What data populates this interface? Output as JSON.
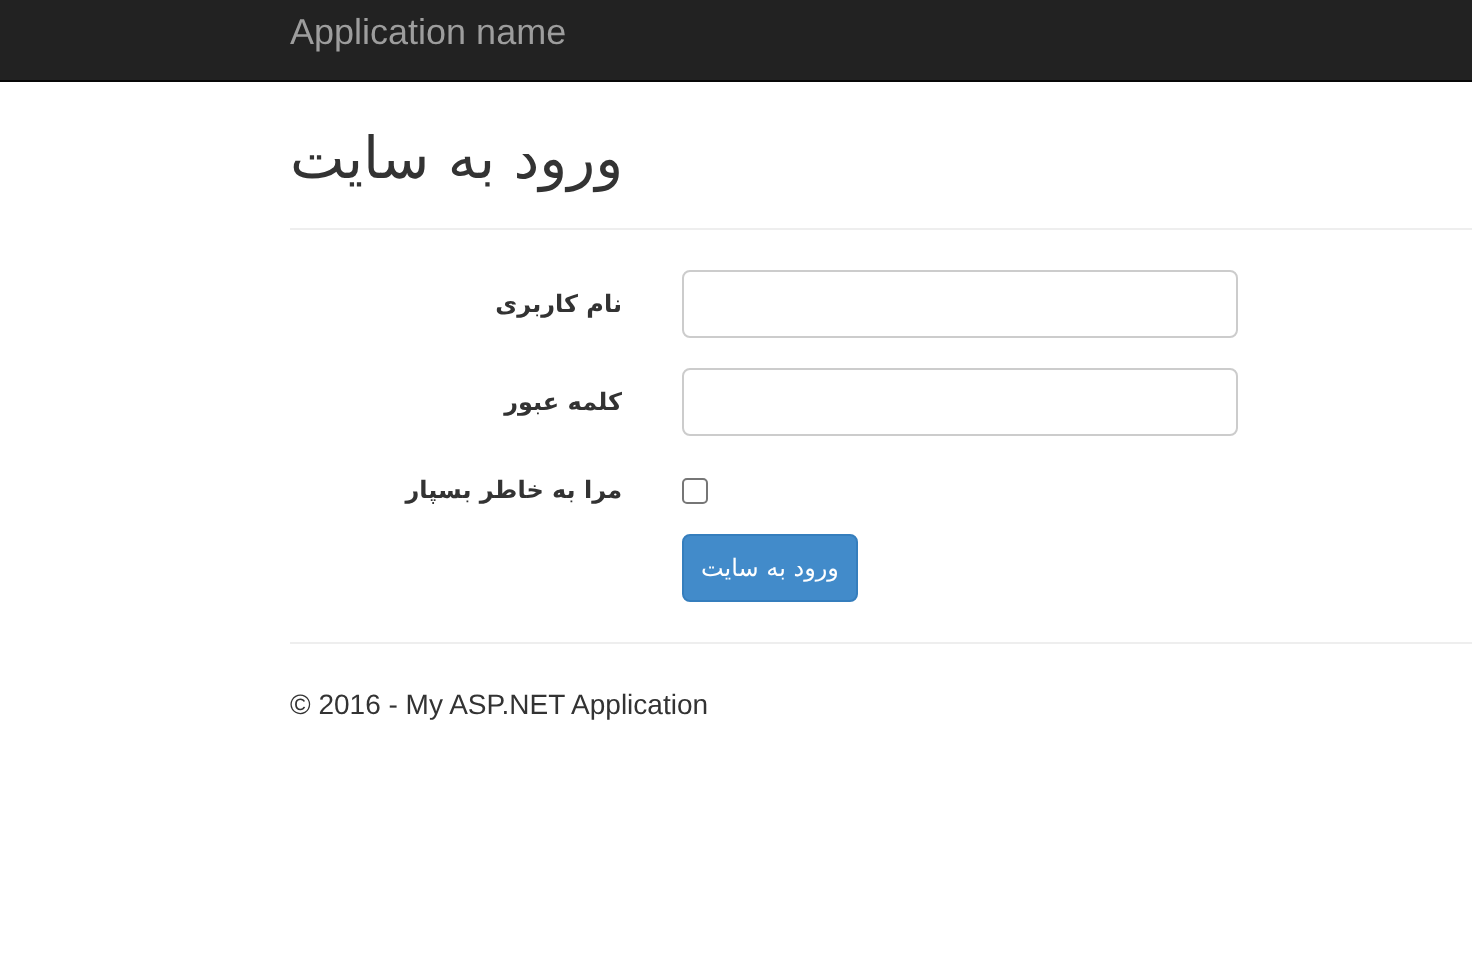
{
  "navbar": {
    "brand": "Application name"
  },
  "page": {
    "title": "ورود به سایت"
  },
  "form": {
    "fields": [
      {
        "kind": "text",
        "label": "نام کاربری"
      },
      {
        "kind": "password",
        "label": "کلمه عبور"
      },
      {
        "kind": "checkbox",
        "label": "مرا به خاطر بسپار",
        "checked": false
      }
    ],
    "submit": "ورود به سایت"
  },
  "footer": {
    "text": "© 2016 - My ASP.NET Application"
  }
}
